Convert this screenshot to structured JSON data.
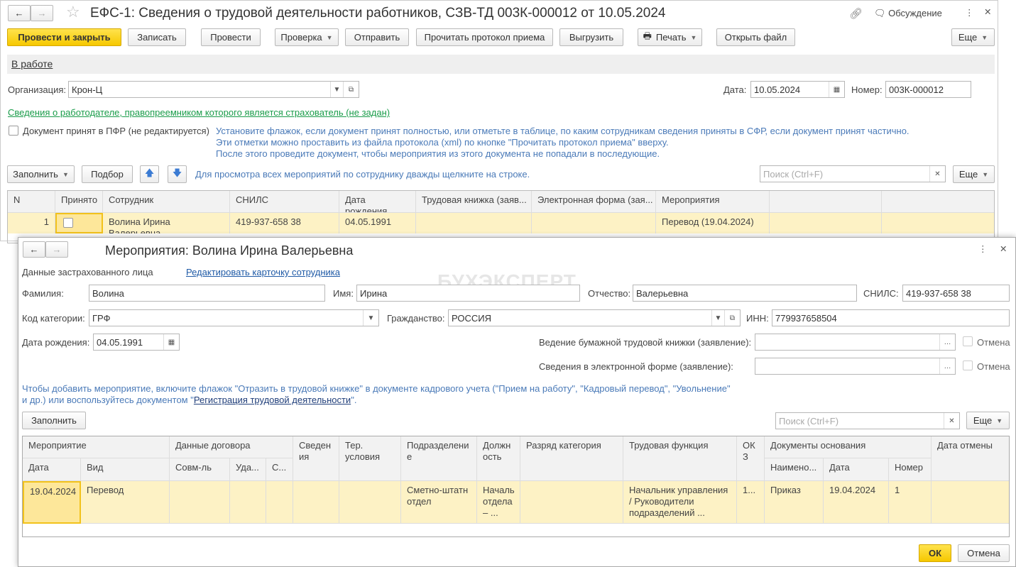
{
  "main": {
    "title": "ЕФС-1: Сведения о трудовой деятельности работников, СЗВ-ТД 003К-000012 от 10.05.2024",
    "discussion": "Обсуждение",
    "toolbar": {
      "post_close": "Провести и закрыть",
      "save": "Записать",
      "post": "Провести",
      "check": "Проверка",
      "send": "Отправить",
      "read_protocol": "Прочитать протокол приема",
      "export": "Выгрузить",
      "print": "Печать",
      "open_file": "Открыть файл",
      "more": "Еще"
    },
    "status": "В работе",
    "org_label": "Организация:",
    "org_value": "Крон-Ц",
    "date_label": "Дата:",
    "date_value": "10.05.2024",
    "number_label": "Номер:",
    "number_value": "003К-000012",
    "employer_link": "Сведения о работодателе, правопреемником которого является страхователь (не задан)",
    "accepted_label": "Документ принят в ПФР (не редактируется)",
    "hint1": "Установите флажок, если документ принят полностью, или отметьте в таблице, по каким сотрудникам сведения приняты в СФР, если документ принят частично.",
    "hint2": "Эти отметки можно проставить из файла протокола (xml) по кнопке \"Прочитать протокол приема\" вверху.",
    "hint3": "После этого проведите документ, чтобы мероприятия из этого документа не попадали в последующие.",
    "fill": "Заполнить",
    "select": "Подбор",
    "table_hint": "Для просмотра всех мероприятий по сотруднику дважды щелкните на строке.",
    "search_placeholder": "Поиск (Ctrl+F)",
    "more": "Еще",
    "columns": [
      "N",
      "Принято",
      "Сотрудник",
      "СНИЛС",
      "Дата рождения",
      "Трудовая книжка (заяв...",
      "Электронная форма (зая...",
      "Мероприятия"
    ],
    "row": {
      "n": "1",
      "employee": "Волина Ирина Валерьевна",
      "snils": "419-937-658 38",
      "birth": "04.05.1991",
      "event": "Перевод (19.04.2024)"
    }
  },
  "dialog": {
    "title": "Мероприятия: Волина Ирина Валерьевна",
    "watermark": "БУХЭКСПЕРТ",
    "insured_label": "Данные застрахованного лица",
    "edit_link": "Редактировать карточку сотрудника",
    "surname_label": "Фамилия:",
    "surname": "Волина",
    "name_label": "Имя:",
    "name": "Ирина",
    "patronymic_label": "Отчество:",
    "patronymic": "Валерьевна",
    "snils_label": "СНИЛС:",
    "snils": "419-937-658 38",
    "category_label": "Код категории:",
    "category": "ГРФ",
    "citizenship_label": "Гражданство:",
    "citizenship": "РОССИЯ",
    "inn_label": "ИНН:",
    "inn": "779937658504",
    "birth_label": "Дата рождения:",
    "birth": "04.05.1991",
    "paper_label": "Ведение бумажной трудовой книжки (заявление):",
    "electronic_label": "Сведения в электронной форме (заявление):",
    "cancel_label": "Отмена",
    "hint_line1": "Чтобы добавить мероприятие, включите флажок \"Отразить в трудовой книжке\" в документе кадрового учета (\"Прием на работу\", \"Кадровый перевод\", \"Увольнение\"",
    "hint_line2a": "и др.) или воспользуйтесь документом \"",
    "hint_link": "Регистрация трудовой деятельности",
    "hint_line2b": "\".",
    "fill": "Заполнить",
    "search_placeholder": "Поиск (Ctrl+F)",
    "more": "Еще",
    "headers": {
      "event": "Мероприятие",
      "date": "Дата",
      "kind": "Вид",
      "contract": "Данные договора",
      "combo": "Совм-ль",
      "remote": "Уда...",
      "c": "С...",
      "info": "Сведен ия",
      "ter": "Тер. условия",
      "dept": "Подразделени е",
      "pos": "Должн ость",
      "rank": "Разряд категория",
      "func": "Трудовая функция",
      "okz": "ОК З",
      "docs": "Документы основания",
      "docname": "Наимено...",
      "docdate": "Дата",
      "docnum": "Номер",
      "cancel_date": "Дата отмены"
    },
    "row": {
      "date": "19.04.2024",
      "kind": "Перевод",
      "dept": "Сметно-штатн отдел",
      "pos": "Началь отдела – ...",
      "func": "Начальник управления / Руководители подразделений ...",
      "okz": "1...",
      "docname": "Приказ",
      "docdate": "19.04.2024",
      "docnum": "1"
    },
    "ok": "ОК",
    "cancel": "Отмена"
  }
}
